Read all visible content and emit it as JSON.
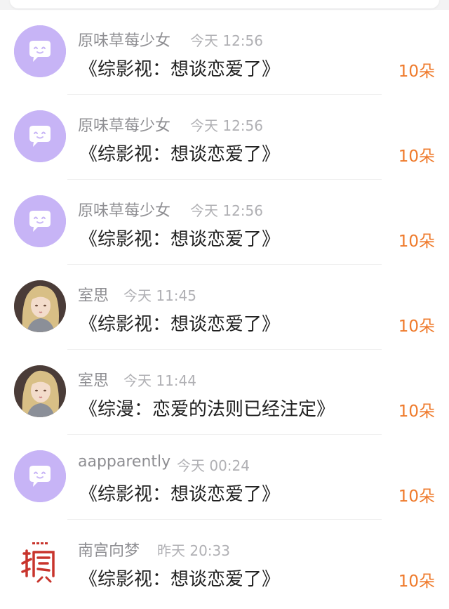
{
  "colors": {
    "accent": "#ef7a2b",
    "default_avatar": "#c7b4f6",
    "name_text": "#8e8e92",
    "time_text": "#b0b0b4",
    "title_text": "#222222"
  },
  "rows": [
    {
      "avatar": "default-chat-avatar-icon",
      "name": "原味草莓少女",
      "time": "今天 12:56",
      "title": "《综影视：想谈恋爱了》",
      "count": "10朵"
    },
    {
      "avatar": "default-chat-avatar-icon",
      "name": "原味草莓少女",
      "time": "今天 12:56",
      "title": "《综影视：想谈恋爱了》",
      "count": "10朵"
    },
    {
      "avatar": "default-chat-avatar-icon",
      "name": "原味草莓少女",
      "time": "今天 12:56",
      "title": "《综影视：想谈恋爱了》",
      "count": "10朵"
    },
    {
      "avatar": "portrait-avatar",
      "name": "室思",
      "time": "今天 11:45",
      "title": "《综影视：想谈恋爱了》",
      "count": "10朵"
    },
    {
      "avatar": "portrait-avatar",
      "name": "室思",
      "time": "今天 11:44",
      "title": "《综漫：恋爱的法则已经注定》",
      "count": "10朵"
    },
    {
      "avatar": "default-chat-avatar-icon",
      "name": "aapparently",
      "time": "今天 00:24",
      "title": "《综影视：想谈恋爱了》",
      "count": "10朵"
    },
    {
      "avatar": "red-logo-avatar",
      "name": "南宫向梦",
      "time": "昨天 20:33",
      "title": "《综影视：想谈恋爱了》",
      "count": "10朵"
    }
  ]
}
